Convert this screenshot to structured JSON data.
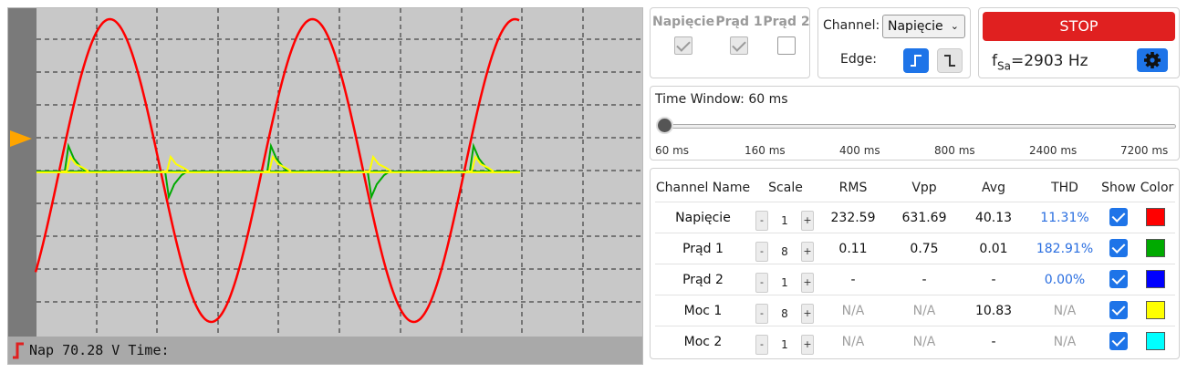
{
  "scope": {
    "status_text": "Nap 70.28 V Time:",
    "trace_colors": {
      "napiecie": "#ff0000",
      "prad1": "#00aa00",
      "moc1": "#ffff00"
    },
    "grid_color": "#222222",
    "background": "#c8c8c8",
    "trigger_marker_color": "#ffa500"
  },
  "channels": {
    "items": [
      {
        "label": "Napięcie",
        "checked": true
      },
      {
        "label": "Prąd 1",
        "checked": true
      },
      {
        "label": "Prąd 2",
        "checked": false
      }
    ]
  },
  "trigger": {
    "channel_label": "Channel:",
    "channel_value": "Napięcie",
    "edge_label": "Edge:"
  },
  "control": {
    "stop_label": "STOP",
    "fsa_prefix": "f",
    "fsa_sub": "Sa",
    "fsa_value": "=2903 Hz"
  },
  "time_window": {
    "title": "Time Window: 60 ms",
    "ticks": [
      "60 ms",
      "160 ms",
      "400 ms",
      "800 ms",
      "2400 ms",
      "7200 ms"
    ],
    "selected_index": 0
  },
  "table": {
    "headers": [
      "Channel Name",
      "Scale",
      "RMS",
      "Vpp",
      "Avg",
      "THD",
      "Show",
      "Color"
    ],
    "rows": [
      {
        "name": "Napięcie",
        "scale": "1",
        "rms": "232.59",
        "vpp": "631.69",
        "avg": "40.13",
        "thd": "11.31%",
        "show": true,
        "color": "#ff0000"
      },
      {
        "name": "Prąd 1",
        "scale": "8",
        "rms": "0.11",
        "vpp": "0.75",
        "avg": "0.01",
        "thd": "182.91%",
        "show": true,
        "color": "#00aa00"
      },
      {
        "name": "Prąd 2",
        "scale": "1",
        "rms": "-",
        "vpp": "-",
        "avg": "-",
        "thd": "0.00%",
        "show": true,
        "color": "#0000ff"
      },
      {
        "name": "Moc 1",
        "scale": "8",
        "rms": "N/A",
        "vpp": "N/A",
        "avg": "10.83",
        "thd": "N/A",
        "show": true,
        "color": "#ffff00"
      },
      {
        "name": "Moc 2",
        "scale": "1",
        "rms": "N/A",
        "vpp": "N/A",
        "avg": "-",
        "thd": "N/A",
        "show": true,
        "color": "#00ffff"
      }
    ],
    "stepper_minus": "-",
    "stepper_plus": "+"
  }
}
